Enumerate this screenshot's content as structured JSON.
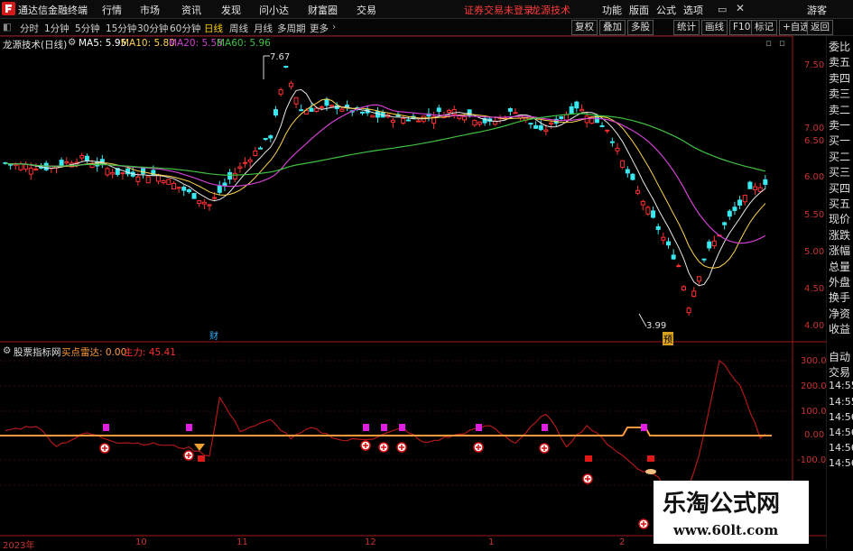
{
  "menubar": {
    "app_title": "通达信金融终端",
    "menus": [
      "行情",
      "市场",
      "资讯",
      "发现",
      "问小达",
      "财富圈",
      "交易"
    ],
    "notice": "证券交易未登录",
    "brand": "龙源技术",
    "right_items": [
      "功能",
      "版面",
      "公式",
      "选项"
    ],
    "user": "游客"
  },
  "toolbar": {
    "periods": [
      "分时",
      "1分钟",
      "5分钟",
      "15分钟",
      "30分钟",
      "60分钟",
      "日线",
      "周线",
      "月线",
      "多周期",
      "更多"
    ],
    "right_buttons": [
      "复权",
      "叠加",
      "多股",
      "统计",
      "画线",
      "F10",
      "标记",
      "+自选",
      "返回"
    ]
  },
  "main_panel": {
    "title": "龙源技术(日线)",
    "ma": [
      {
        "label": "MA5: 5.95",
        "color": "#ffffff"
      },
      {
        "label": "MA10: 5.80",
        "color": "#ffd34d"
      },
      {
        "label": "MA20: 5.58",
        "color": "#d040d0"
      },
      {
        "label": "MA60: 5.96",
        "color": "#40c040"
      }
    ],
    "high_label": "7.67",
    "low_label": "3.99",
    "markers": [
      "财",
      "预"
    ],
    "y_ticks": [
      "7.50",
      "7.00",
      "6.50",
      "6.00",
      "5.50",
      "5.00",
      "4.50",
      "4.00"
    ]
  },
  "sub_panel": {
    "title": "股票指标网",
    "indicator": "买点雷达: 0.00",
    "indicator2": "主力: 45.41",
    "y_ticks": [
      "300.0",
      "200.0",
      "100.0",
      "0.00",
      "-100.0"
    ]
  },
  "x_axis": [
    "2023年",
    "10",
    "11",
    "12",
    "1",
    "2"
  ],
  "right_panel": [
    "委比",
    "卖五",
    "卖四",
    "卖三",
    "卖二",
    "卖一",
    "买一",
    "买二",
    "买三",
    "买四",
    "买五",
    "现价",
    "涨跌",
    "涨幅",
    "总量",
    "外盘",
    "换手",
    "净资",
    "收益"
  ],
  "right_panel_sub": [
    "自动",
    "交易",
    "14:55",
    "14:55",
    "14:56",
    "14:56",
    "14:56",
    "14:56"
  ],
  "watermark": {
    "line1": "乐淘公式网",
    "line2": "www.60lt.com"
  },
  "colors": {
    "up": "#ff3030",
    "down": "#39e8f0",
    "axis": "#a01818"
  }
}
